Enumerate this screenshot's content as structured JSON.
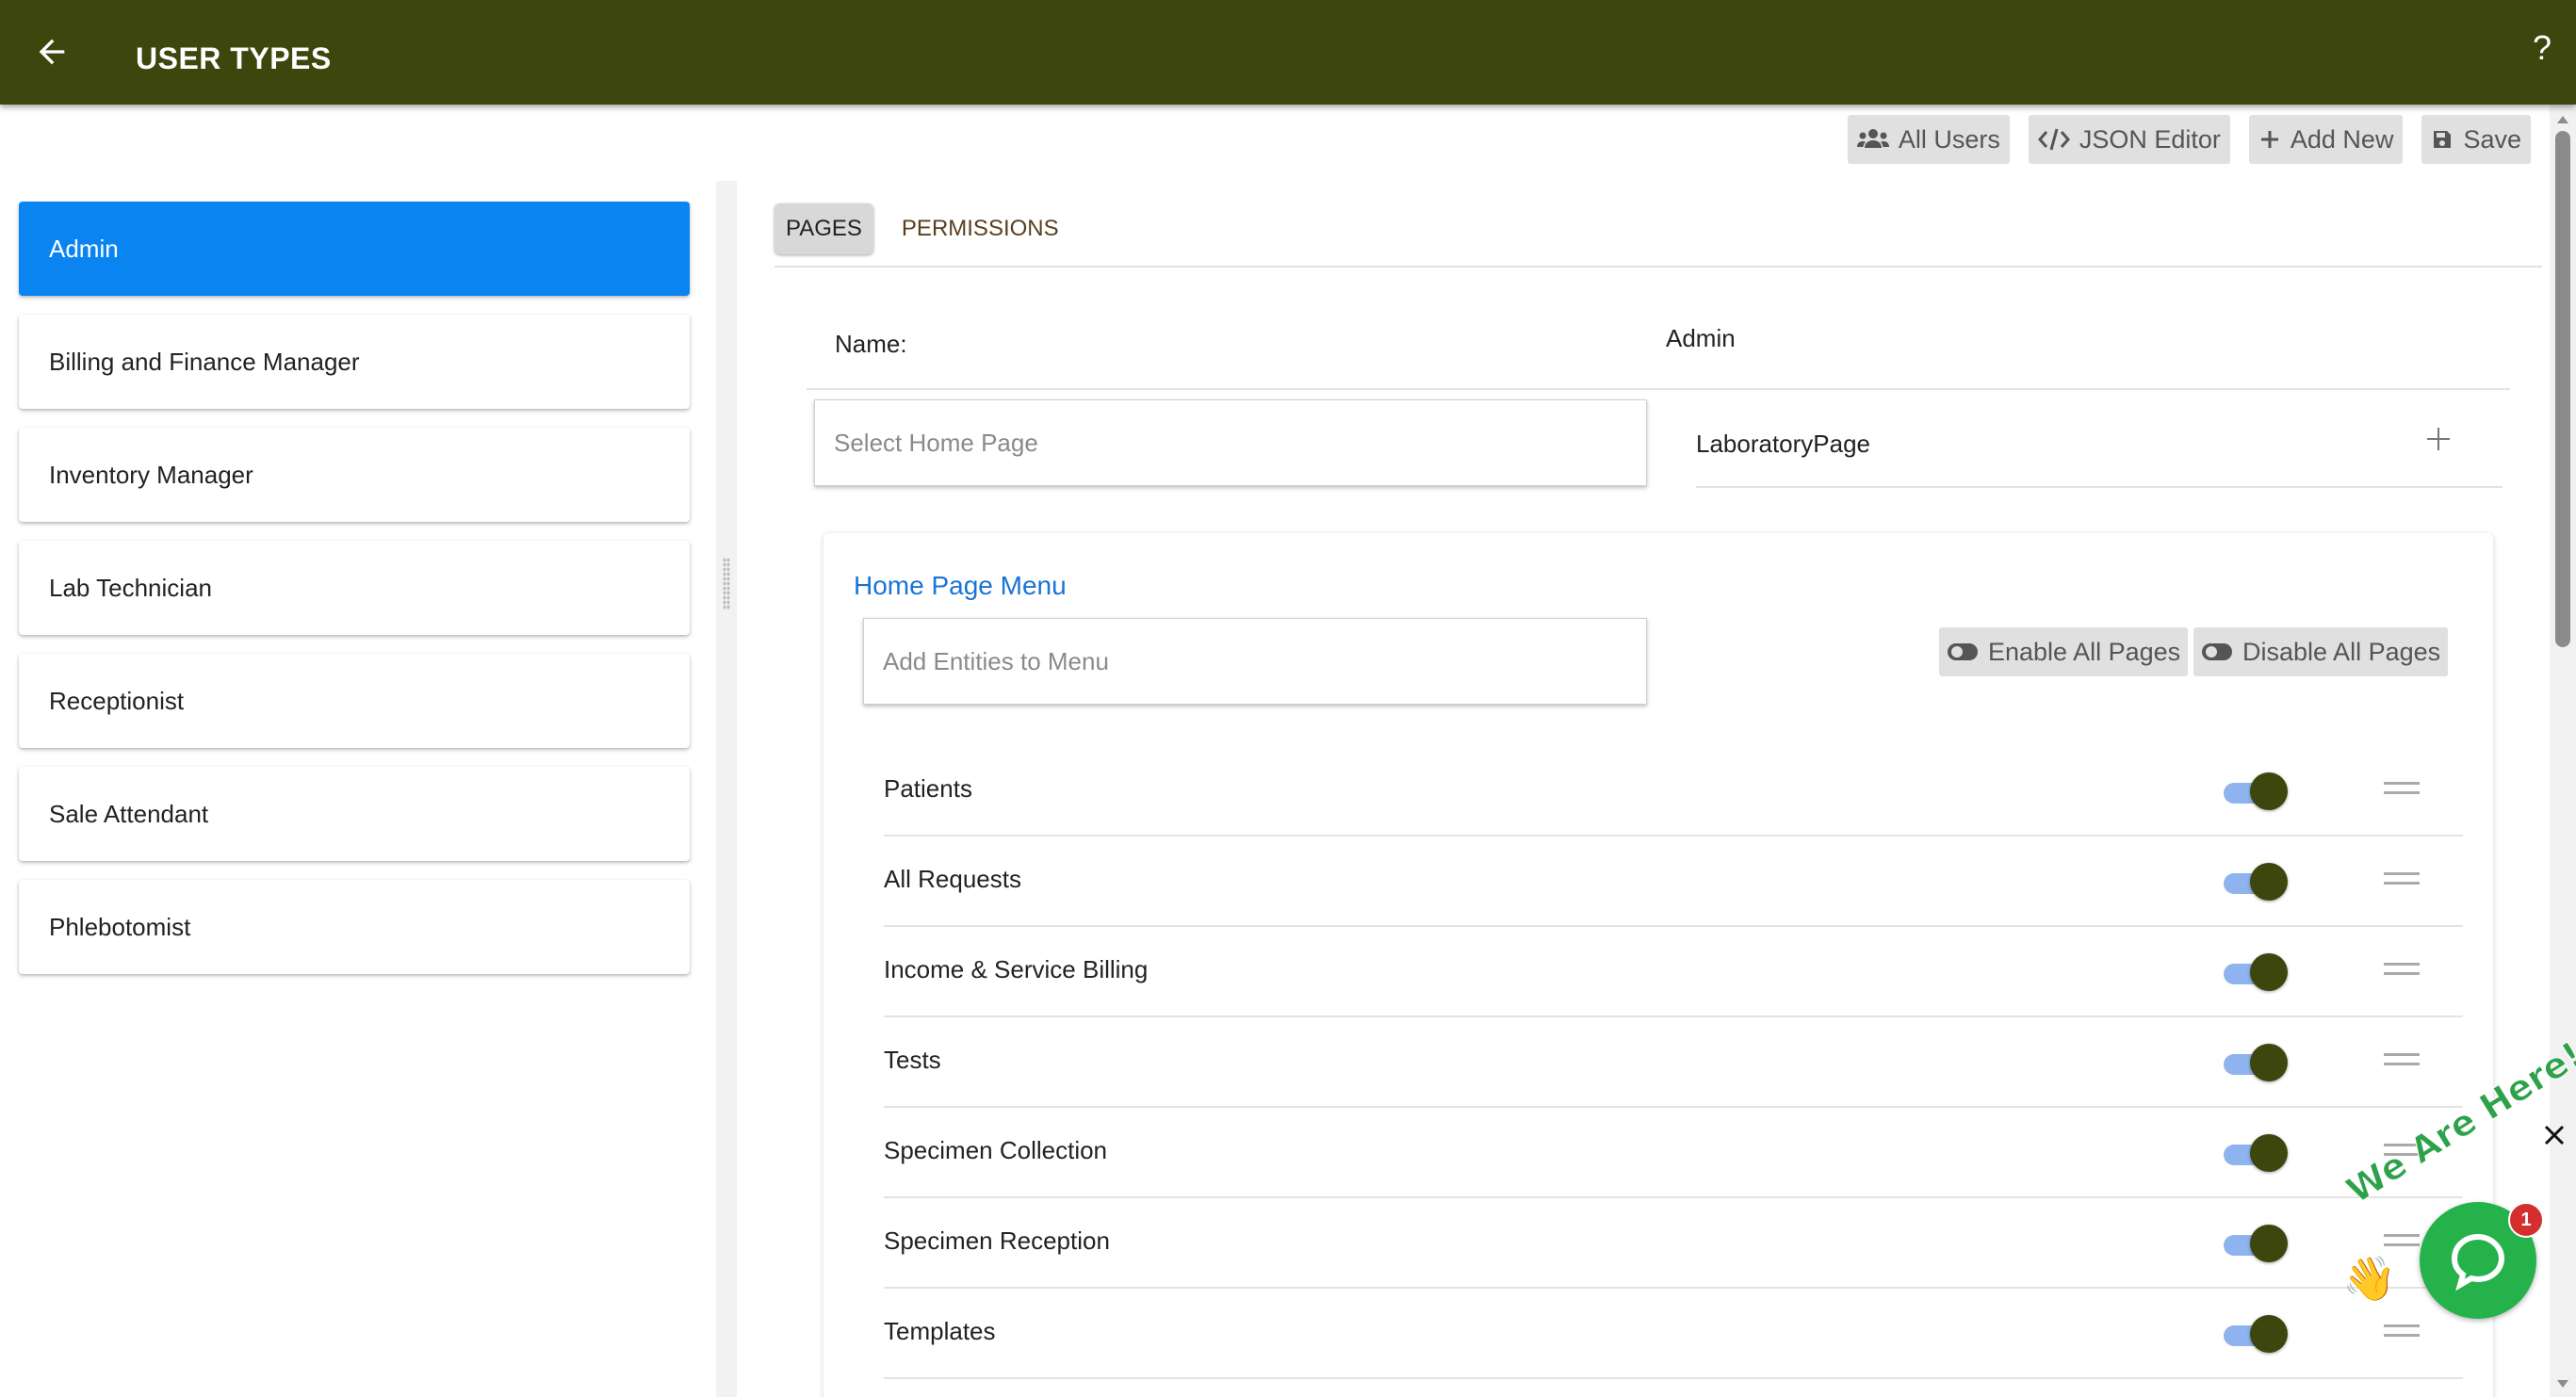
{
  "header": {
    "title": "USER TYPES",
    "help_label": "?"
  },
  "toolbar": {
    "all_users": "All Users",
    "json_editor": "JSON Editor",
    "add_new": "Add New",
    "save": "Save"
  },
  "sidebar": {
    "roles": [
      {
        "label": "Admin",
        "active": true
      },
      {
        "label": "Billing and Finance Manager",
        "active": false
      },
      {
        "label": "Inventory Manager",
        "active": false
      },
      {
        "label": "Lab Technician",
        "active": false
      },
      {
        "label": "Receptionist",
        "active": false
      },
      {
        "label": "Sale Attendant",
        "active": false
      },
      {
        "label": "Phlebotomist",
        "active": false
      }
    ]
  },
  "tabs": {
    "pages": "PAGES",
    "permissions": "PERMISSIONS"
  },
  "form": {
    "name_label": "Name:",
    "name_value": "Admin",
    "home_page_placeholder": "Select Home Page",
    "home_page_value": "LaboratoryPage"
  },
  "menu": {
    "title": "Home Page Menu",
    "entities_placeholder": "Add Entities to Menu",
    "enable_all": "Enable All Pages",
    "disable_all": "Disable All Pages",
    "pages": [
      {
        "label": "Patients",
        "enabled": true
      },
      {
        "label": "All Requests",
        "enabled": true
      },
      {
        "label": "Income & Service Billing",
        "enabled": true
      },
      {
        "label": "Tests",
        "enabled": true
      },
      {
        "label": "Specimen Collection",
        "enabled": true
      },
      {
        "label": "Specimen Reception",
        "enabled": true
      },
      {
        "label": "Templates",
        "enabled": true
      }
    ]
  },
  "chat": {
    "tagline": "We Are Here!",
    "badge_count": "1"
  },
  "colors": {
    "appbar": "#3d460d",
    "active_role": "#0a84f0",
    "menu_title": "#1a73d6",
    "toggle_track": "#8fb3ef",
    "chat_green": "#26b24b"
  }
}
